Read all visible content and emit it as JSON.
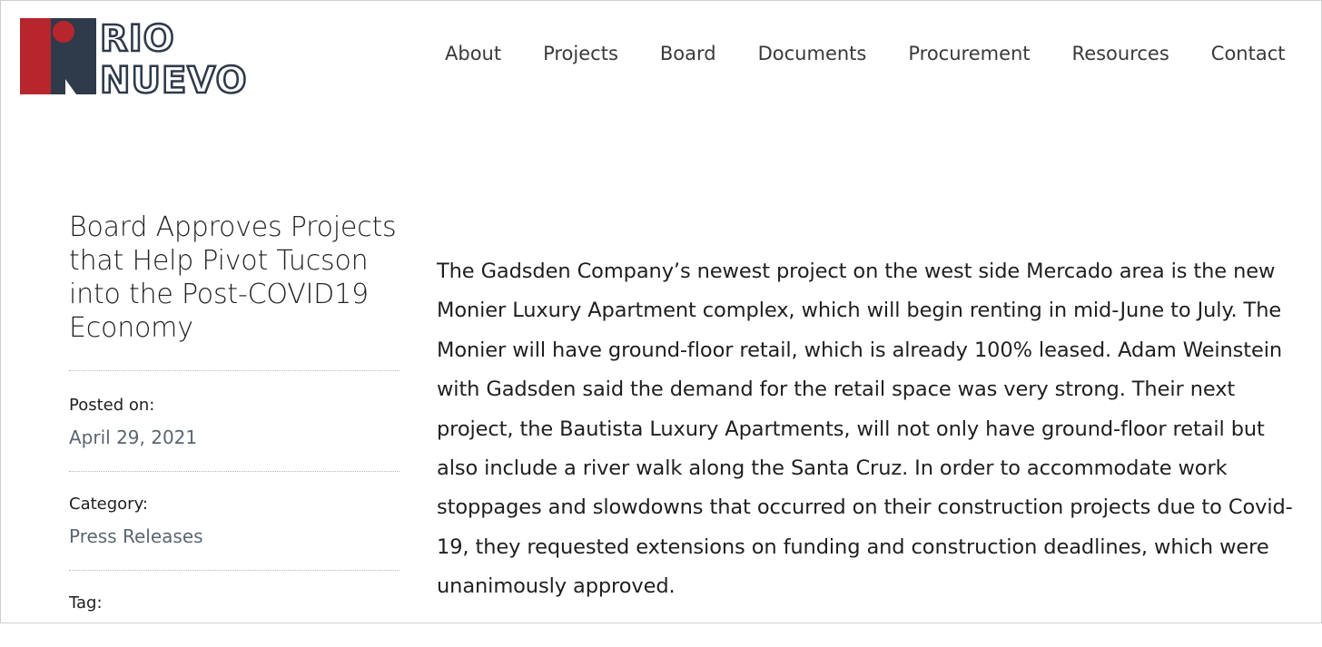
{
  "header": {
    "logo": {
      "line1": "RIO",
      "line2": "NUEVO",
      "colors": {
        "red": "#b8262d",
        "navy": "#2f3a4a"
      }
    },
    "nav": [
      {
        "label": "About"
      },
      {
        "label": "Projects"
      },
      {
        "label": "Board"
      },
      {
        "label": "Documents"
      },
      {
        "label": "Procurement"
      },
      {
        "label": "Resources"
      },
      {
        "label": "Contact"
      }
    ]
  },
  "sidebar": {
    "title": "Board Approves Projects that Help Pivot Tucson into the Post-COVID19 Economy",
    "posted_on": {
      "label": "Posted on:",
      "value": "April 29, 2021"
    },
    "category": {
      "label": "Category:",
      "value": "Press Releases"
    },
    "tag": {
      "label": "Tag:"
    }
  },
  "main": {
    "paragraph": "The Gadsden Company’s newest project on the west side Mercado area is the new Monier Luxury Apartment complex, which will begin renting in mid-June to July. The Monier will have ground-floor retail, which is already 100% leased. Adam Weinstein with Gadsden said the demand for the retail space was very strong. Their next project, the Bautista Luxury Apartments, will not only have ground-floor retail but also include a river walk along the Santa Cruz. In order to accommodate work stoppages and slowdowns that occurred on their construction projects due to Covid-19, they requested extensions on funding and construction deadlines, which were unanimously approved."
  }
}
